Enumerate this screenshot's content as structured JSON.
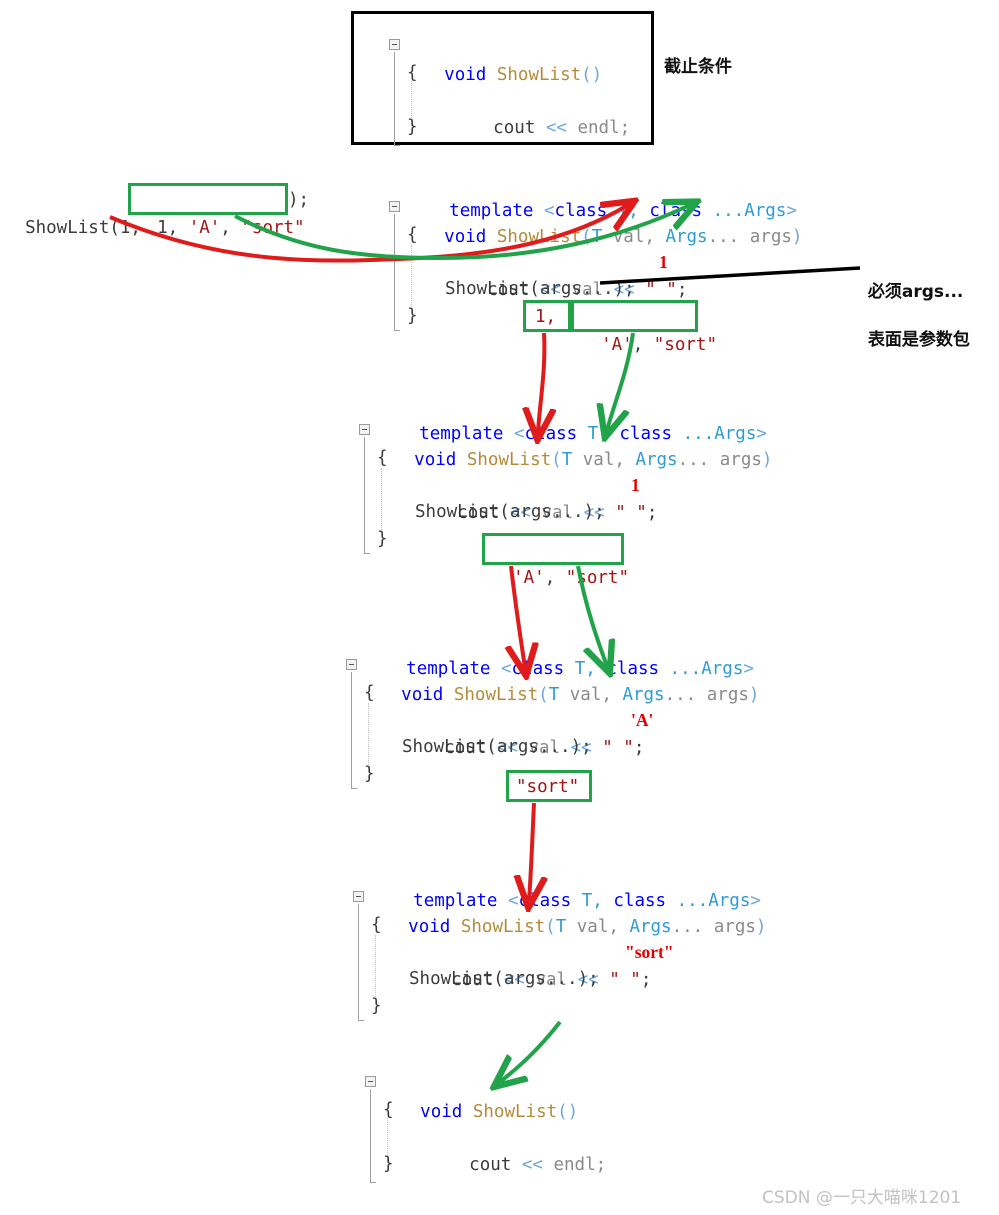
{
  "annotations": {
    "termination": "截止条件",
    "must_args_line1": "必须args...",
    "must_args_line2": "表面是参数包"
  },
  "watermark": "CSDN @一只大喵咪1201",
  "call_site": {
    "prefix": "ShowList(1, ",
    "boxed": "1, 'A', \"sort\"",
    "suffix": ");"
  },
  "code": {
    "base_case": {
      "sig_kw": "void",
      "sig_name": " ShowList",
      "sig_args": "()",
      "open_brace": "{",
      "body": "cout << endl;",
      "cout": "cout",
      "shift": " << ",
      "endl": "endl;",
      "close_brace": "}"
    },
    "variadic": {
      "template_kw": "template ",
      "template_lt": "<",
      "template_class1": "class",
      "template_T": " T, ",
      "template_class2": "class",
      "template_args": " ...Args",
      "template_gt": ">",
      "sig_kw": "void",
      "sig_name": " ShowList",
      "sig_open": "(",
      "sig_T": "T",
      "sig_val": " val, ",
      "sig_Args": "Args",
      "sig_dots": "... ",
      "sig_args": "args",
      "sig_close": ")",
      "open_brace": "{",
      "cout": "cout ",
      "shift1": "<< ",
      "val": "val ",
      "shift2": "<< ",
      "space_literal": "\" \"",
      "semi": ";",
      "recurse": "ShowList(args...);",
      "close_brace": "}"
    }
  },
  "frames": [
    {
      "id": "frame-1",
      "value": "1",
      "printed": "1"
    },
    {
      "id": "frame-2",
      "value": "'A'",
      "printed": "1"
    },
    {
      "id": "frame-3",
      "value": "\"sort\"",
      "printed": "'A'"
    },
    {
      "id": "frame-4",
      "value": "",
      "printed": "\"sort\""
    }
  ],
  "boxes": {
    "call_args": "1, 'A', \"sort\"",
    "pack_first": "1,",
    "pack_rest": "'A', \"sort\"",
    "pack_2": "'A', \"sort\"",
    "pack_3": "\"sort\""
  },
  "printed_markers": {
    "f1": "1",
    "f2": "1",
    "f3": "'A'",
    "f4": "\"sort\""
  },
  "colors": {
    "keyword": "#0000ff",
    "function": "#b58b3a",
    "type": "#2e9bd6",
    "variable": "#8a8a8a",
    "string": "#a31515",
    "red_arrow": "#e01b1b",
    "green_arrow": "#22a34a",
    "black_line": "#000000"
  }
}
